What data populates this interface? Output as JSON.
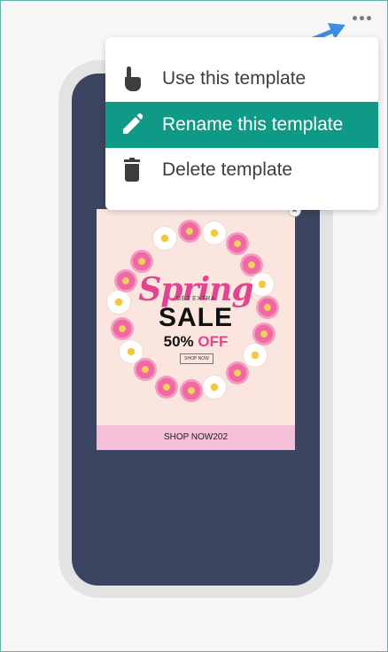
{
  "menu": {
    "items": [
      {
        "label": "Use this template",
        "icon": "pointer-hand-icon"
      },
      {
        "label": "Rename this template",
        "icon": "pencil-icon",
        "active": true
      },
      {
        "label": "Delete template",
        "icon": "trash-icon"
      }
    ]
  },
  "promo": {
    "headline": "Spring",
    "subheadline": "GET EXTRA",
    "main": "SALE",
    "discount_value": "50%",
    "discount_word": "OFF",
    "small_button": "SHOP NOW",
    "cta_label": "SHOP NOW202"
  },
  "colors": {
    "accent": "#0f9a88",
    "phone_screen": "#3b4460",
    "promo_pink": "#e2458f",
    "arrow": "#3a8ee6"
  }
}
